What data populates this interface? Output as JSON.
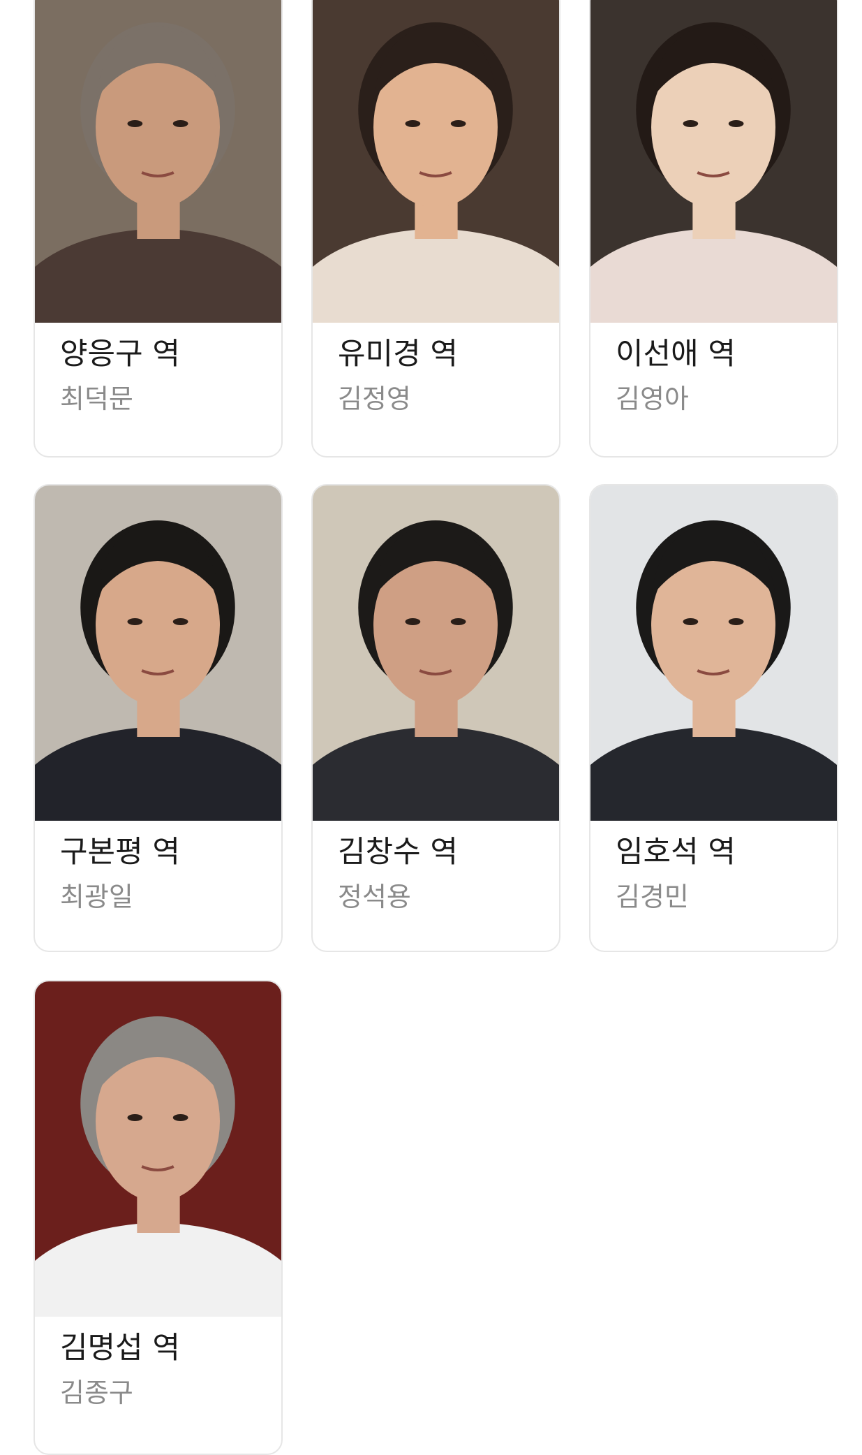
{
  "cast": [
    {
      "role": "양응구 역",
      "actor": "최덕문",
      "bg": "#7b6e61",
      "skin": "#c99a7c",
      "hair": "#7b7168",
      "clothes": "#4b3a34"
    },
    {
      "role": "유미경 역",
      "actor": "김정영",
      "bg": "#4a3a31",
      "skin": "#e2b391",
      "hair": "#2a1f1a",
      "clothes": "#e8dcd0"
    },
    {
      "role": "이선애 역",
      "actor": "김영아",
      "bg": "#3b332e",
      "skin": "#ecd0b8",
      "hair": "#231a16",
      "clothes": "#e9dad4"
    },
    {
      "role": "구본평 역",
      "actor": "최광일",
      "bg": "#bfb9b0",
      "skin": "#d7a88a",
      "hair": "#1a1816",
      "clothes": "#22232a"
    },
    {
      "role": "김창수 역",
      "actor": "정석용",
      "bg": "#cfc7b8",
      "skin": "#cf9f84",
      "hair": "#1c1a18",
      "clothes": "#2b2c31"
    },
    {
      "role": "임호석 역",
      "actor": "김경민",
      "bg": "#e2e4e6",
      "skin": "#e0b598",
      "hair": "#1a1918",
      "clothes": "#25272d"
    },
    {
      "role": "김명섭 역",
      "actor": "김종구",
      "bg": "#6b1f1c",
      "skin": "#d6a88e",
      "hair": "#8b8884",
      "clothes": "#f1f1f1"
    }
  ]
}
